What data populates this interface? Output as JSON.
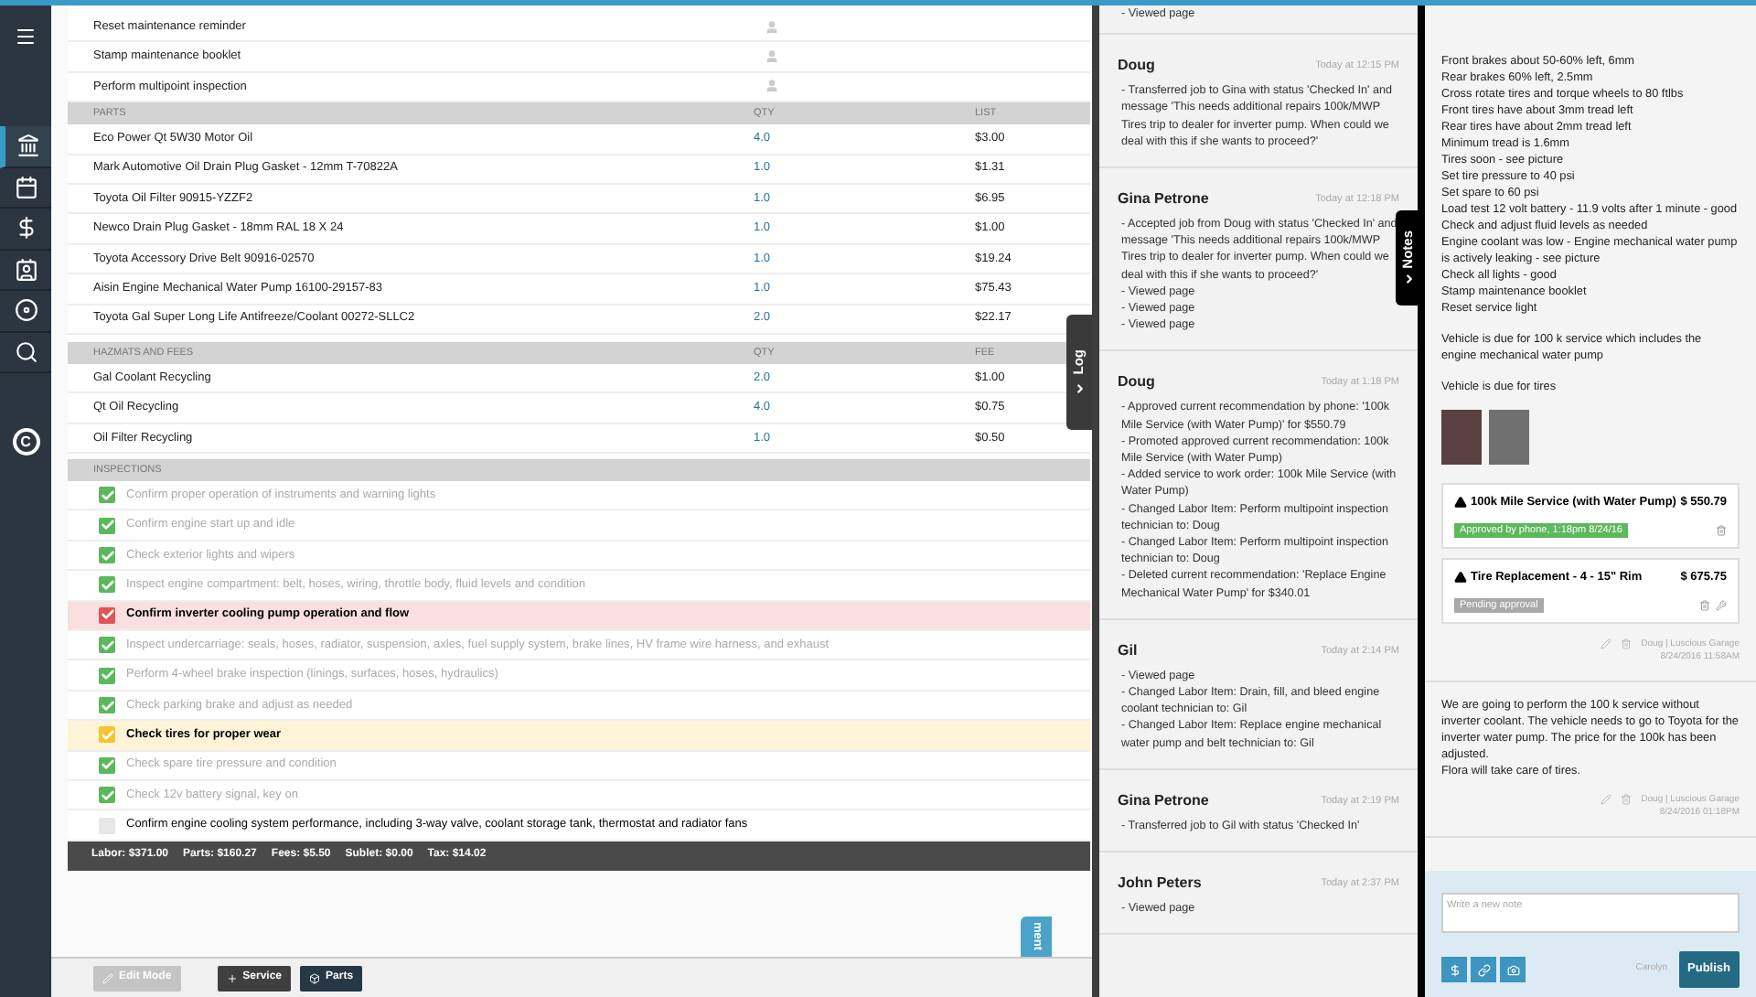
{
  "sidebar": {
    "items": [
      {
        "kind": "building",
        "selected": true
      },
      {
        "kind": "calendar",
        "selected": false
      },
      {
        "kind": "dollar",
        "selected": false
      },
      {
        "kind": "contacts",
        "selected": false
      },
      {
        "kind": "disc",
        "selected": false
      },
      {
        "kind": "search",
        "selected": false
      }
    ],
    "logo_letter": "C"
  },
  "labor_rows": [
    {
      "name": "Reset maintenance reminder"
    },
    {
      "name": "Stamp maintenance booklet"
    },
    {
      "name": "Perform multipoint inspection"
    }
  ],
  "parts": {
    "columns": [
      "PARTS",
      "QTY",
      "LIST"
    ],
    "rows": [
      {
        "name": "Eco Power Qt 5W30 Motor Oil",
        "qty": "4.0",
        "price": "$3.00"
      },
      {
        "name": "Mark Automotive Oil Drain Plug Gasket - 12mm T-70822A",
        "qty": "1.0",
        "price": "$1.31"
      },
      {
        "name": "Toyota Oil Filter 90915-YZZF2",
        "qty": "1.0",
        "price": "$6.95"
      },
      {
        "name": "Newco Drain Plug Gasket - 18mm RAL 18 X 24",
        "qty": "1.0",
        "price": "$1.00"
      },
      {
        "name": "Toyota Accessory Drive Belt 90916-02570",
        "qty": "1.0",
        "price": "$19.24"
      },
      {
        "name": "Aisin Engine Mechanical Water Pump 16100-29157-83",
        "qty": "1.0",
        "price": "$75.43"
      },
      {
        "name": "Toyota Gal Super Long Life Antifreeze/Coolant 00272-SLLC2",
        "qty": "2.0",
        "price": "$22.17"
      }
    ]
  },
  "hazmats": {
    "columns": [
      "HAZMATS AND FEES",
      "QTY",
      "FEE"
    ],
    "rows": [
      {
        "name": "Gal Coolant Recycling",
        "qty": "2.0",
        "price": "$1.00"
      },
      {
        "name": "Qt Oil Recycling",
        "qty": "4.0",
        "price": "$0.75"
      },
      {
        "name": "Oil Filter Recycling",
        "qty": "1.0",
        "price": "$0.50"
      }
    ]
  },
  "inspections": {
    "title": "INSPECTIONS",
    "items": [
      {
        "text": "Confirm proper operation of instruments and warning lights",
        "checked": true,
        "highlighted": false,
        "color": "#5cb85c"
      },
      {
        "text": "Confirm engine start up and idle",
        "checked": true,
        "highlighted": false,
        "color": "#5cb85c"
      },
      {
        "text": "Check exterior lights and wipers",
        "checked": true,
        "highlighted": false,
        "color": "#5cb85c"
      },
      {
        "text": "Inspect engine compartment: belt, hoses, wiring, throttle body, fluid levels and condition",
        "checked": true,
        "highlighted": false,
        "color": "#5cb85c"
      },
      {
        "text": "Confirm inverter cooling pump operation and flow",
        "checked": true,
        "highlighted": true,
        "color": "#e05555"
      },
      {
        "text": "Inspect undercarriage: seals, hoses, radiator, suspension, axles, fuel supply system, brake lines, HV frame wire harness, and exhaust",
        "checked": true,
        "highlighted": false,
        "color": "#5cb85c"
      },
      {
        "text": "Perform 4-wheel brake inspection (linings, surfaces, hoses, hydraulics)",
        "checked": true,
        "highlighted": false,
        "color": "#5cb85c"
      },
      {
        "text": "Check parking brake and adjust as needed",
        "checked": true,
        "highlighted": false,
        "color": "#5cb85c"
      },
      {
        "text": "Check tires for proper wear",
        "checked": true,
        "highlighted": true,
        "color": "#f5c431"
      },
      {
        "text": "Check spare tire pressure and condition",
        "checked": true,
        "highlighted": false,
        "color": "#5cb85c"
      },
      {
        "text": "Check 12v battery signal, key on",
        "checked": true,
        "highlighted": false,
        "color": "#5cb85c"
      },
      {
        "text": "Confirm engine cooling system performance, including 3-way valve, coolant storage tank, thermostat and radiator fans",
        "checked": false,
        "highlighted": false,
        "color": "#e6e6e6"
      }
    ]
  },
  "totals": [
    "Labor: $371.00",
    "Parts: $160.27",
    "Fees: $5.50",
    "Sublet: $0.00",
    "Tax: $14.02"
  ],
  "toolbar": {
    "buttons": [
      {
        "label": "Edit Mode",
        "kind": "edit",
        "disabled": true
      },
      {
        "label": "Service",
        "kind": "service",
        "disabled": false
      },
      {
        "label": "Parts",
        "kind": "parts",
        "disabled": false
      }
    ]
  },
  "side_tab": "ment",
  "log_tab": "Log",
  "log": {
    "entries": [
      {
        "lines": [
          "- Viewed page"
        ]
      },
      {
        "author": "Doug",
        "time": "Today at 12:15 PM",
        "lines": [
          "- Transferred job to Gina with status 'Checked In' and message 'This needs additional repairs 100k/MWP Tires trip to dealer for inverter pump. When could we deal with this if she wants to proceed?'"
        ]
      },
      {
        "author": "Gina Petrone",
        "time": "Today at 12:18 PM",
        "lines": [
          "- Accepted job from Doug with status 'Checked In' and message 'This needs additional repairs 100k/MWP Tires trip to dealer for inverter pump. When could we deal with this if she wants to proceed?'",
          "- Viewed page",
          "- Viewed page",
          "- Viewed page"
        ]
      },
      {
        "author": "Doug",
        "time": "Today at 1:18 PM",
        "lines": [
          "- Approved current recommendation by phone: '100k Mile Service (with Water Pump)' for $550.79",
          "- Promoted approved current recommendation: 100k Mile Service (with Water Pump)",
          "- Added service to work order: 100k Mile Service (with Water Pump)",
          "- Changed Labor Item: Perform multipoint inspection technician to: Doug",
          "- Changed Labor Item: Perform multipoint inspection technician to: Doug",
          "- Deleted current recommendation: 'Replace Engine Mechanical Water Pump' for $340.01"
        ]
      },
      {
        "author": "Gil",
        "time": "Today at 2:14 PM",
        "lines": [
          "- Viewed page",
          "- Changed Labor Item: Drain, fill, and bleed engine coolant technician to: Gil",
          "- Changed Labor Item: Replace engine mechanical water pump and belt technician to: Gil"
        ]
      },
      {
        "author": "Gina Petrone",
        "time": "Today at 2:19 PM",
        "lines": [
          "- Transferred job to Gil with status 'Checked In'"
        ]
      },
      {
        "author": "John Peters",
        "time": "Today at 2:37 PM",
        "lines": [
          "- Viewed page"
        ]
      }
    ]
  },
  "notes_tab": "Notes",
  "notes": {
    "items": [
      {
        "paragraphs": [
          [
            "Front brakes about 50-60% left, 6mm",
            "Rear brakes 60% left, 2.5mm",
            "Cross rotate tires and torque wheels to 80 ftlbs",
            "Front tires have about 3mm tread left",
            "Rear tires have about 2mm tread left",
            "Minimum tread is 1.6mm",
            "Tires soon - see picture",
            "Set tire pressure to 40 psi",
            "Set spare to 60 psi",
            "Load test 12 volt battery - 11.9 volts after 1 minute - good",
            "Check and adjust fluid levels as needed",
            "Engine coolant was low - Engine mechanical water pump is actively leaking - see picture",
            "Check all lights - good",
            "Stamp maintenance booklet",
            "Reset service light"
          ],
          [
            "Vehicle is due for 100 k service which includes the engine mechanical water pump"
          ],
          [
            "Vehicle is due for tires"
          ]
        ],
        "photos": [
          {
            "kind": "engine"
          },
          {
            "kind": "tire"
          }
        ],
        "recommendations": [
          {
            "title": "100k Mile Service (with Water Pump)",
            "price": "$ 550.79",
            "status": "Approved by phone, 1:18pm 8/24/16",
            "approved": true,
            "wrench": false
          },
          {
            "title": "Tire Replacement - 4 - 15\" Rim",
            "price": "$ 675.75",
            "status": "Pending approval",
            "approved": false,
            "wrench": true
          }
        ],
        "author": "Doug | Luscious Garage",
        "date": "8/24/2016 11:58AM"
      },
      {
        "paragraphs": [
          [
            "We are going to perform the 100 k service without inverter coolant. The vehicle needs to go to Toyota for the inverter water pump. The price for the 100k has been adjusted.",
            "Flora will take care of tires."
          ]
        ],
        "author": "Doug | Luscious Garage",
        "date": "8/24/2016 01:18PM"
      }
    ]
  },
  "composer": {
    "placeholder": "Write a new note",
    "user": "Carolyn",
    "publish": "Publish"
  }
}
